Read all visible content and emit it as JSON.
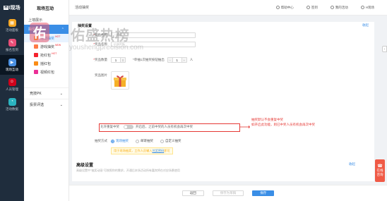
{
  "rail": {
    "logo_box": "H",
    "logo_text": "I现场",
    "items": [
      {
        "label": "活动面板",
        "color": "#f5a623",
        "glyph": "▦"
      },
      {
        "label": "报名签到",
        "color": "#e94e77",
        "glyph": "✎"
      },
      {
        "label": "现场互动",
        "color": "#4a90e2",
        "glyph": "▶"
      },
      {
        "label": "人员管理",
        "color": "#d0021b",
        "glyph": "☺"
      },
      {
        "label": "活动数据",
        "color": "#2bb3c0",
        "glyph": "◔"
      }
    ]
  },
  "sidebar": {
    "title": "现场互动",
    "groups": [
      {
        "label": "上墙展示"
      },
      {
        "label": "抽奖游戏"
      }
    ],
    "items": [
      {
        "label": "活动抽奖",
        "hot": "HOT",
        "color": "#f5a623"
      },
      {
        "label": "游戏抽奖",
        "hot": "NEW",
        "color": "#ff7a45"
      },
      {
        "label": "抢红包",
        "hot": "HOT",
        "color": "#f5222d"
      },
      {
        "label": "摇红包",
        "hot": "",
        "color": "#fa8c16"
      },
      {
        "label": "视频红包",
        "hot": "",
        "color": "#eb2f96"
      }
    ],
    "sections": [
      {
        "label": "竞技PK"
      },
      {
        "label": "投票评选"
      }
    ]
  },
  "topbar": {
    "title": "活动抽奖",
    "links": [
      {
        "label": "帮助中心"
      },
      {
        "label": "签到"
      },
      {
        "label": "我的活动"
      },
      {
        "label": "H现场"
      }
    ]
  },
  "form": {
    "section_title": "抽奖设置",
    "collapse": "收起",
    "name_label": "奖品名称",
    "name_placeholder": "一等奖",
    "prize_label": "奖品名称",
    "prize_placeholder": "小米平板",
    "qty_label": "奖品数量",
    "qty_value": "1",
    "each_label": "每次抽",
    "each_value": "1",
    "each_unit": "人",
    "each_prefix": "*单抽1次抽奖按钮抽出",
    "image_label": "奖品图片",
    "repeat_label": "允许重复中奖",
    "repeat_text": "开启后，之前中奖的人员有机会再次中奖",
    "mode_label": "抽奖方式",
    "modes": [
      {
        "label": "现场抽奖",
        "on": true
      },
      {
        "label": "邮寄抽奖",
        "on": false
      },
      {
        "label": "自定义抽奖",
        "on": false
      }
    ],
    "warn_text": "用于现场抽奖，工作人员输入",
    "warn_link": "兑奖密码",
    "warn_tail": "即可",
    "advanced_title": "高级设置",
    "advanced_sub": "高级设置中\"抽奖动画\"可按照你的需求，开通后本场活动所有嘉宾将在对应场景使用"
  },
  "annotation": {
    "line1": "抽奖默认不会重复中奖",
    "line2": "如开启此功能，则已中奖人员有机会再次中奖"
  },
  "footer": {
    "back": "返回",
    "save_draft": "保存为草稿",
    "save": "保存"
  },
  "float": {
    "icon": "☎",
    "line1": "在线",
    "line2": "咨询"
  },
  "watermark": {
    "logo": "佑",
    "text": "佑盛热榜",
    "url": "youshengprecision.com"
  }
}
